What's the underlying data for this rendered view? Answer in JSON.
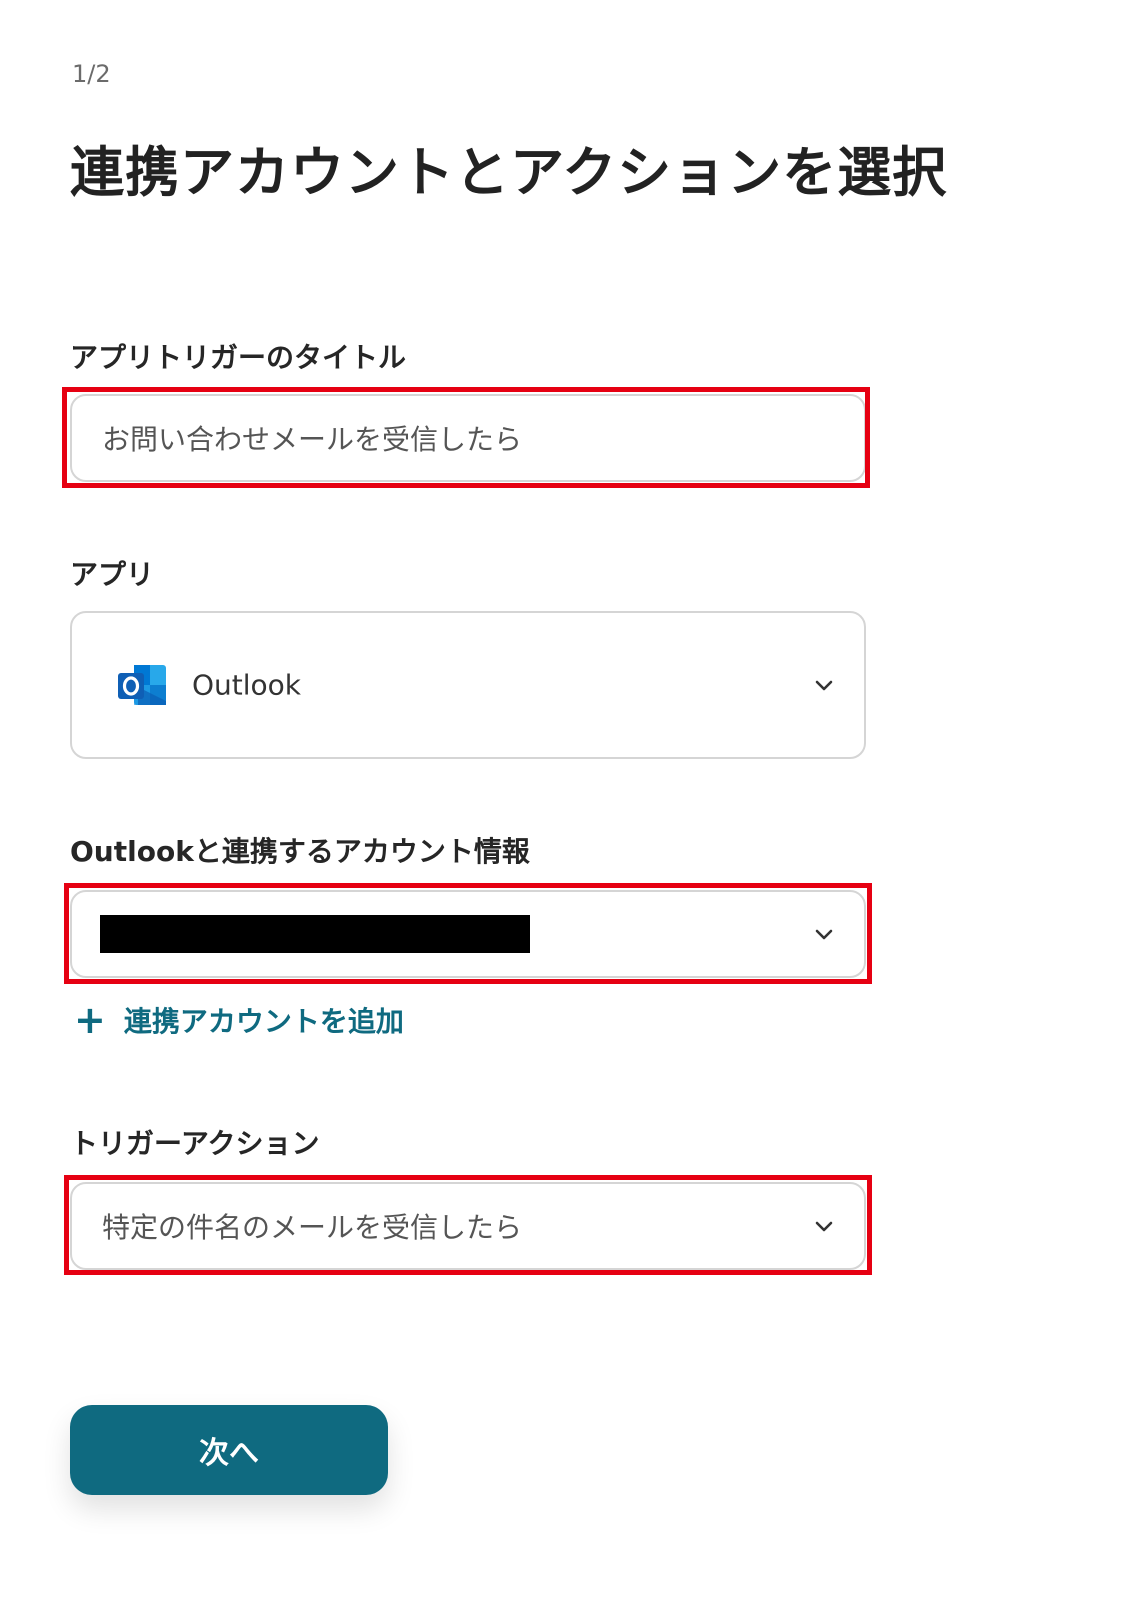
{
  "header": {
    "step": "1/2",
    "title": "連携アカウントとアクションを選択"
  },
  "trigger_title": {
    "label": "アプリトリガーのタイトル",
    "value": "お問い合わせメールを受信したら"
  },
  "app": {
    "label": "アプリ",
    "selected": "Outlook",
    "icon": "outlook-icon"
  },
  "account": {
    "label": "Outlookと連携するアカウント情報",
    "add_label": "連携アカウントを追加",
    "add_icon": "plus-icon"
  },
  "trigger_action": {
    "label": "トリガーアクション",
    "selected": "特定の件名のメールを受信したら"
  },
  "footer": {
    "next_label": "次へ"
  },
  "colors": {
    "accent": "#0f6a80",
    "highlight": "#e60012",
    "outlook_blue": "#0a5eb5"
  }
}
